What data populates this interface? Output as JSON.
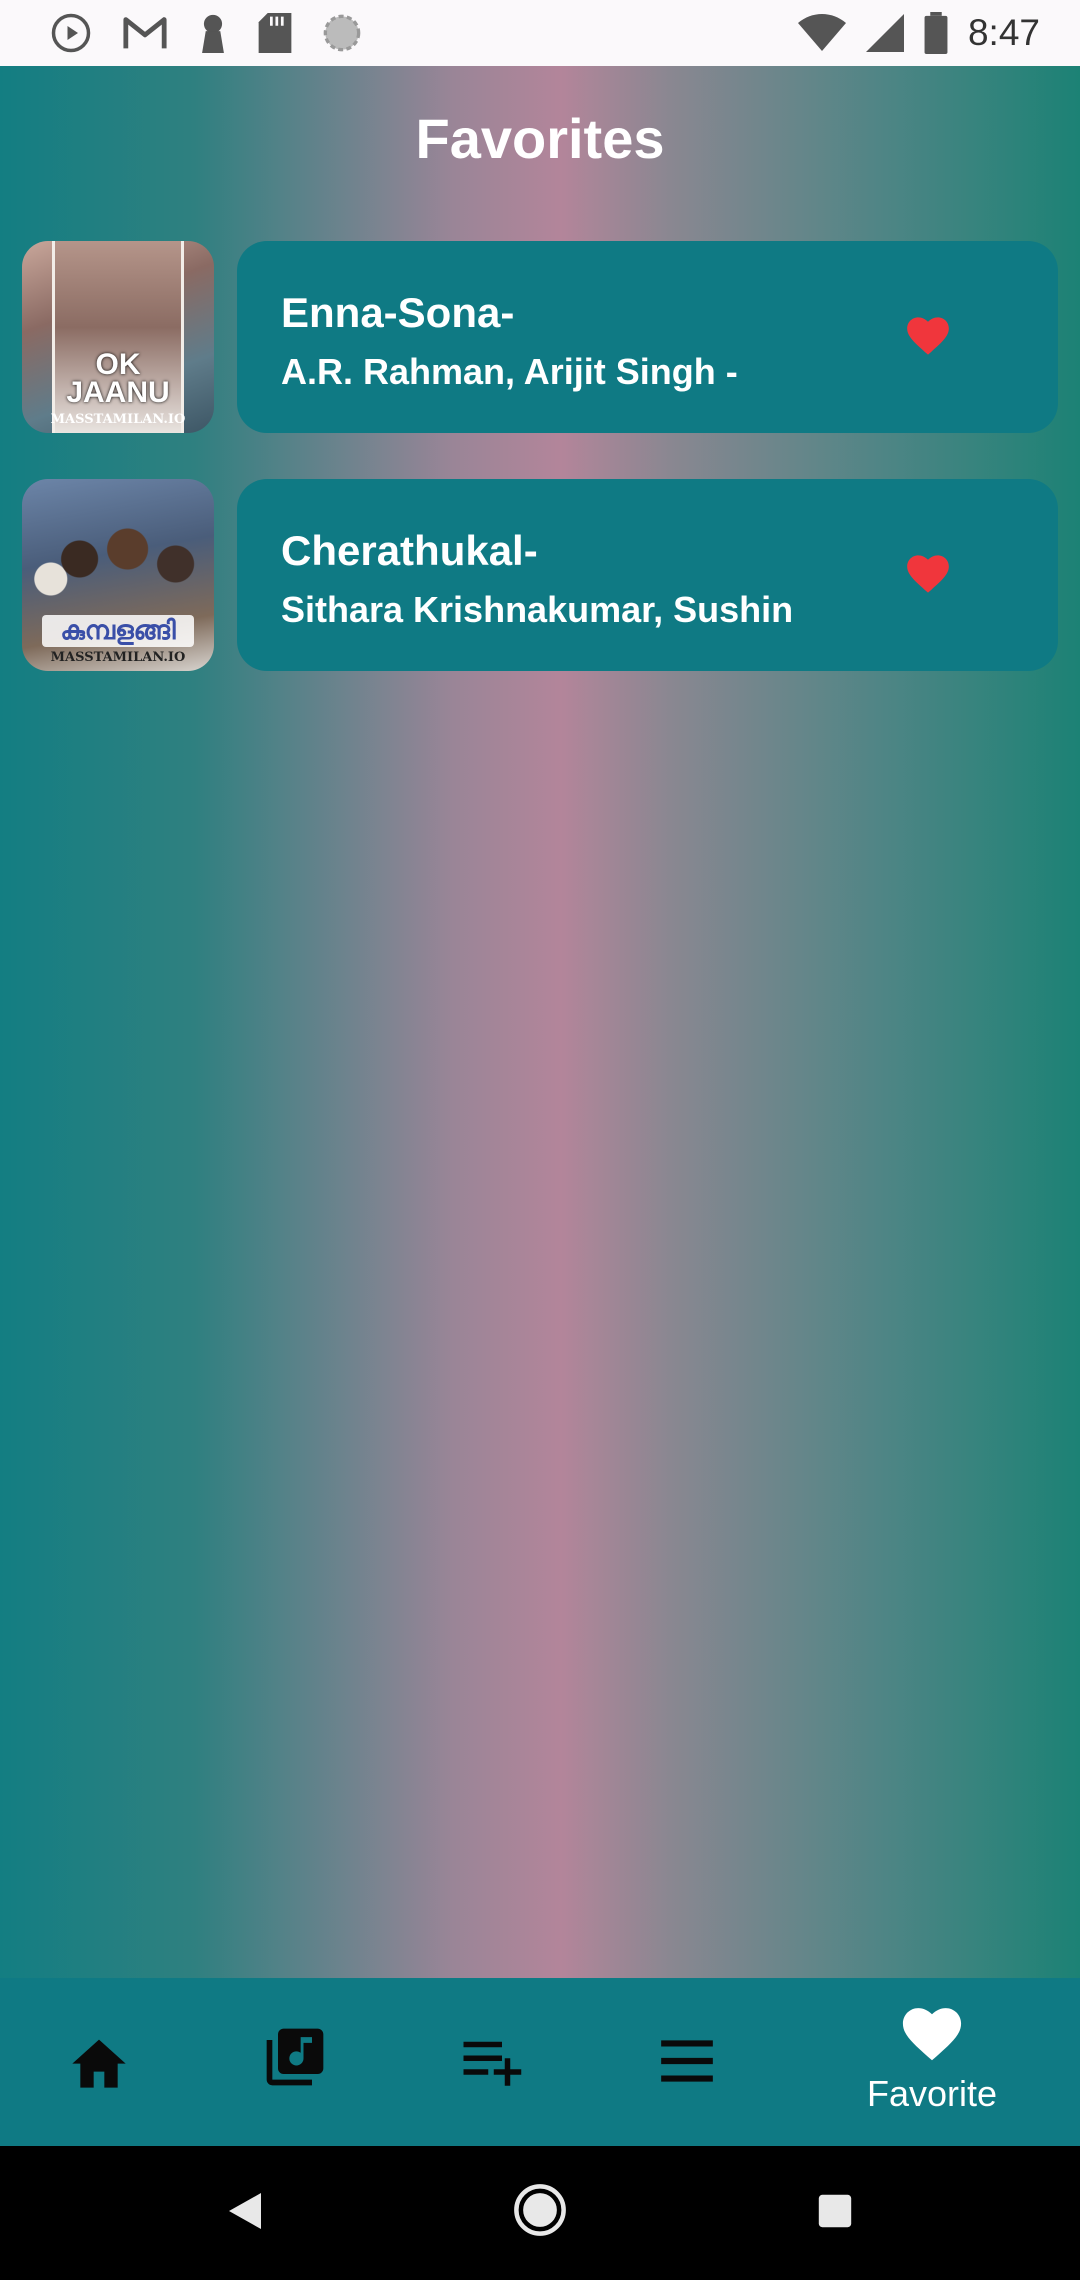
{
  "status_bar": {
    "time": "8:47",
    "icons_left": [
      "play-icon",
      "gmail-icon",
      "keyhole-icon",
      "sd-card-icon",
      "loading-icon"
    ],
    "icons_right": [
      "wifi-icon",
      "signal-icon",
      "battery-icon"
    ]
  },
  "header": {
    "title": "Favorites"
  },
  "favorites": [
    {
      "title": "Enna-Sona-",
      "artists": "A.R. Rahman, Arijit Singh -",
      "art_text": "OK JAANU",
      "art_caption": "MASSTAMILAN.IO",
      "favorited": true
    },
    {
      "title": "Cherathukal-",
      "artists": "Sithara Krishnakumar, Sushin",
      "art_text": "കുമ്പളങ്ങി",
      "art_caption": "MASSTAMILAN.IO",
      "favorited": true
    }
  ],
  "bottom_nav": {
    "items": [
      {
        "icon": "home-icon"
      },
      {
        "icon": "library-music-icon"
      },
      {
        "icon": "playlist-add-icon"
      },
      {
        "icon": "menu-icon"
      },
      {
        "icon": "heart-icon",
        "label": "Favorite",
        "active": true
      }
    ]
  },
  "colors": {
    "card": "#0f7a84",
    "heart": "#f0363c",
    "nav_bg": "#0f7a84"
  }
}
